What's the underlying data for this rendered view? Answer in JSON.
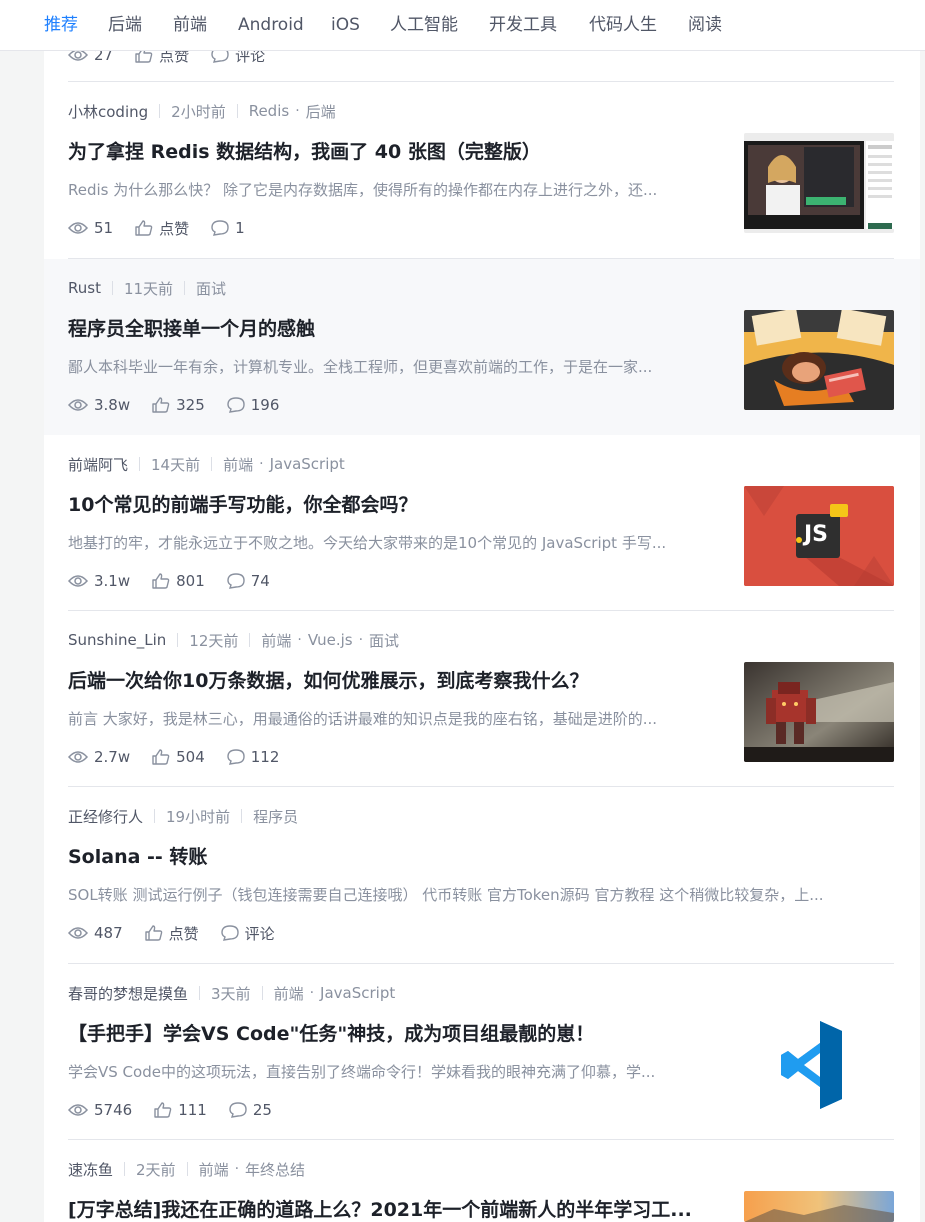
{
  "nav": {
    "items": [
      "推荐",
      "后端",
      "前端",
      "Android",
      "iOS",
      "人工智能",
      "开发工具",
      "代码人生",
      "阅读"
    ],
    "active": "推荐"
  },
  "partial_top": {
    "views": "27",
    "like": "点赞",
    "comment": "评论"
  },
  "articles": [
    {
      "author": "小林coding",
      "time": "2小时前",
      "tags": [
        "Redis",
        "后端"
      ],
      "title": "为了拿捏 Redis 数据结构，我画了 40 张图（完整版）",
      "abstract": "Redis 为什么那么快？ 除了它是内存数据库，使得所有的操作都在内存上进行之外，还...",
      "views": "51",
      "likes": "点赞",
      "comments": "1",
      "thumb": "video-screenshot"
    },
    {
      "author": "Rust",
      "time": "11天前",
      "tags": [
        "面试"
      ],
      "title": "程序员全职接单一个月的感触",
      "abstract": "鄙人本科毕业一年有余，计算机专业。全栈工程师，但更喜欢前端的工作，于是在一家...",
      "views": "3.8w",
      "likes": "325",
      "comments": "196",
      "thumb": "desk-illustration"
    },
    {
      "author": "前端阿飞",
      "time": "14天前",
      "tags": [
        "前端",
        "JavaScript"
      ],
      "title": "10个常见的前端手写功能，你全都会吗？",
      "abstract": "地基打的牢，才能永远立于不败之地。今天给大家带来的是10个常见的 JavaScript 手写...",
      "views": "3.1w",
      "likes": "801",
      "comments": "74",
      "thumb": "js-logo",
      "thumb_text": "JS"
    },
    {
      "author": "Sunshine_Lin",
      "time": "12天前",
      "tags": [
        "前端",
        "Vue.js",
        "面试"
      ],
      "title": "后端一次给你10万条数据，如何优雅展示，到底考察我什么？",
      "abstract": "前言 大家好，我是林三心，用最通俗的话讲最难的知识点是我的座右铭，基础是进阶的...",
      "views": "2.7w",
      "likes": "504",
      "comments": "112",
      "thumb": "robot-art"
    },
    {
      "author": "正经修行人",
      "time": "19小时前",
      "tags": [
        "程序员"
      ],
      "title": "Solana -- 转账",
      "abstract": "SOL转账 测试运行例子（钱包连接需要自己连接哦） 代币转账 官方Token源码 官方教程 这个稍微比较复杂，上...",
      "views": "487",
      "likes": "点赞",
      "comments": "评论",
      "thumb": ""
    },
    {
      "author": "春哥的梦想是摸鱼",
      "time": "3天前",
      "tags": [
        "前端",
        "JavaScript"
      ],
      "title": "【手把手】学会VS Code\"任务\"神技，成为项目组最靓的崽！",
      "abstract": "学会VS Code中的这项玩法，直接告别了终端命令行！学妹看我的眼神充满了仰慕，学...",
      "views": "5746",
      "likes": "111",
      "comments": "25",
      "thumb": "vscode-logo"
    },
    {
      "author": "速冻鱼",
      "time": "2天前",
      "tags": [
        "前端",
        "年终总结"
      ],
      "title": "[万字总结]我还在正确的道路上么？2021年一个前端新人的半年学习工...",
      "abstract": "",
      "views": "",
      "likes": "",
      "comments": "",
      "thumb": "sunset-photo"
    }
  ]
}
